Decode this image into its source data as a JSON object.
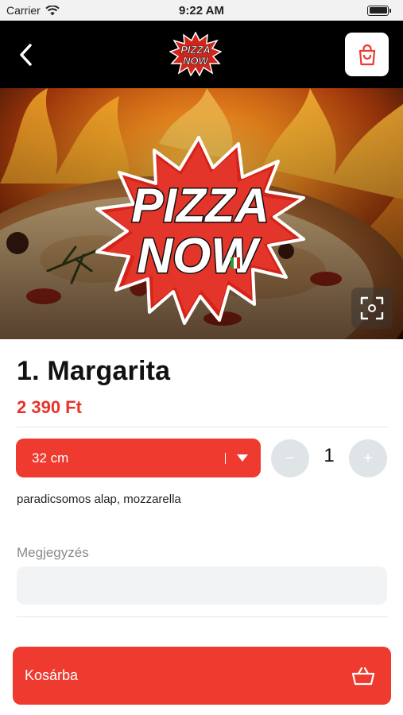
{
  "status_bar": {
    "carrier": "Carrier",
    "time": "9:22 AM"
  },
  "header": {
    "logo_line1": "PIZZA",
    "logo_line2": "NOW"
  },
  "hero": {
    "logo_line1": "PIZZA",
    "logo_line2": "NOW"
  },
  "product": {
    "title": "1. Margarita",
    "price": "2 390 Ft",
    "ingredients": "paradicsomos alap, mozzarella"
  },
  "size_select": {
    "value": "32 cm"
  },
  "quantity": {
    "minus": "−",
    "value": "1",
    "plus": "+"
  },
  "note": {
    "label": "Megjegyzés",
    "placeholder": ""
  },
  "add_to_cart": {
    "label": "Kosárba"
  },
  "colors": {
    "accent": "#ee3a2f",
    "price": "#e8332a",
    "header_bg": "#000000"
  }
}
